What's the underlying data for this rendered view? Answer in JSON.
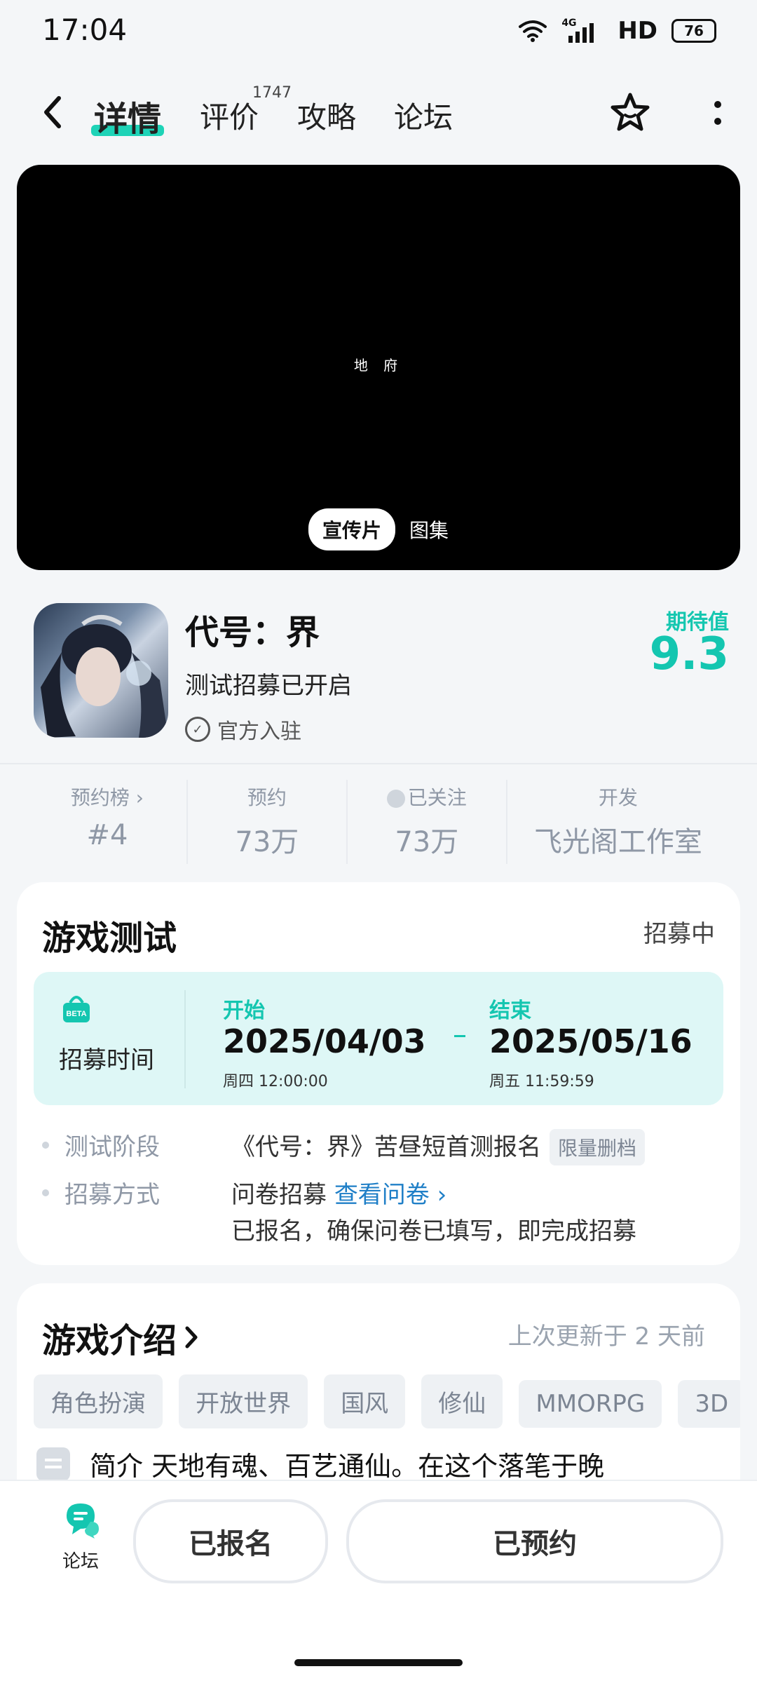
{
  "status_bar": {
    "time": "17:04",
    "network": "4G",
    "hd": "HD",
    "battery": "76"
  },
  "nav": {
    "tabs": [
      {
        "label": "详情"
      },
      {
        "label": "评价"
      },
      {
        "label": "攻略"
      },
      {
        "label": "论坛"
      }
    ],
    "review_count": "1747"
  },
  "media": {
    "video_title": "地 府",
    "tab_active": "宣传片",
    "tab_other": "图集"
  },
  "game": {
    "title": "代号：界",
    "subtitle": "测试招募已开启",
    "official": "官方入驻",
    "expect_label": "期待值",
    "expect_score": "9.3"
  },
  "stats": [
    {
      "label": "预约榜 ›",
      "value": "#4"
    },
    {
      "label": "预约",
      "value": "73万"
    },
    {
      "label": "已关注",
      "value": "73万"
    },
    {
      "label": "开发",
      "value": "飞光阁工作室"
    }
  ],
  "test_card": {
    "title": "游戏测试",
    "status": "招募中",
    "timebox": {
      "icon_text": "BETA",
      "label": "招募时间",
      "start_label": "开始",
      "start_date": "2025/04/03",
      "start_time": "周四  12:00:00",
      "end_label": "结束",
      "end_date": "2025/05/16",
      "end_time": "周五  11:59:59"
    },
    "rows": [
      {
        "label": "测试阶段",
        "value": "《代号：界》苦昼短首测报名",
        "tag": "限量删档"
      },
      {
        "label": "招募方式",
        "value": "问卷招募",
        "link": "查看问卷 ›",
        "note": "已报名，确保问卷已填写，即完成招募"
      }
    ]
  },
  "intro_card": {
    "title": "游戏介绍",
    "updated": "上次更新于 2 天前",
    "tags": [
      "角色扮演",
      "开放世界",
      "国风",
      "修仙",
      "MMORPG",
      "3D"
    ],
    "summary": "简介 天地有魂、百艺通仙。在这个落笔于晚"
  },
  "bottom_bar": {
    "forum_label": "论坛",
    "btn_signed": "已报名",
    "btn_reserved": "已预约"
  },
  "colors": {
    "accent": "#14c6b0",
    "link": "#1f7fc7"
  }
}
